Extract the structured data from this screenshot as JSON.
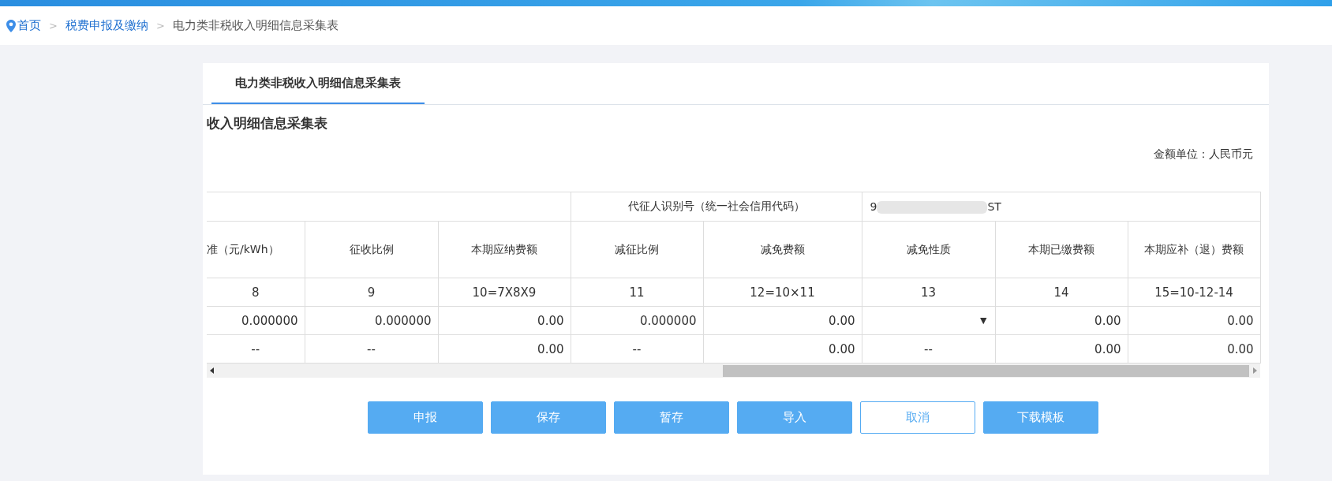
{
  "breadcrumb": [
    {
      "label": "首页",
      "kind": "link"
    },
    {
      "label": "税费申报及缴纳",
      "kind": "link"
    },
    {
      "label": "电力类非税收入明细信息采集表",
      "kind": "current"
    }
  ],
  "breadcrumb_separator": ">",
  "tabs": [
    {
      "label": "电力类非税收入明细信息采集表",
      "selected": true
    }
  ],
  "form_title": "收入明细信息采集表",
  "unit_note": "金额单位：人民币元",
  "table": {
    "agent_id_label": "代征人识别号（统一社会信用代码）",
    "agent_id_start": "9",
    "agent_id_end": "ST",
    "columns": [
      "准（元/kWh）",
      "征收比例",
      "本期应纳费额",
      "减征比例",
      "减免费额",
      "减免性质",
      "本期已缴费额",
      "本期应补（退）费额"
    ],
    "index_row": [
      "8",
      "9",
      "10=7X8X9",
      "11",
      "12=10×11",
      "13",
      "14",
      "15=10-12-14"
    ],
    "rows": [
      {
        "cells": [
          {
            "kind": "text",
            "value": "0.000000"
          },
          {
            "kind": "text",
            "value": "0.000000"
          },
          {
            "kind": "text",
            "value": "0.00"
          },
          {
            "kind": "text",
            "value": "0.000000"
          },
          {
            "kind": "text",
            "value": "0.00"
          },
          {
            "kind": "select"
          },
          {
            "kind": "text",
            "value": "0.00"
          },
          {
            "kind": "text",
            "value": "0.00"
          }
        ]
      },
      {
        "cells": [
          {
            "kind": "dash",
            "value": "--"
          },
          {
            "kind": "dash",
            "value": "--"
          },
          {
            "kind": "text",
            "value": "0.00"
          },
          {
            "kind": "dash",
            "value": "--"
          },
          {
            "kind": "text",
            "value": "0.00"
          },
          {
            "kind": "dash",
            "value": "--"
          },
          {
            "kind": "text",
            "value": "0.00"
          },
          {
            "kind": "text",
            "value": "0.00"
          }
        ]
      }
    ],
    "dropdown_arrow": "▼"
  },
  "buttons": [
    {
      "label": "申报",
      "kind": "primary"
    },
    {
      "label": "保存",
      "kind": "primary"
    },
    {
      "label": "暂存",
      "kind": "primary"
    },
    {
      "label": "导入",
      "kind": "primary"
    },
    {
      "label": "取消",
      "kind": "outline"
    },
    {
      "label": "下载模板",
      "kind": "primary"
    }
  ]
}
